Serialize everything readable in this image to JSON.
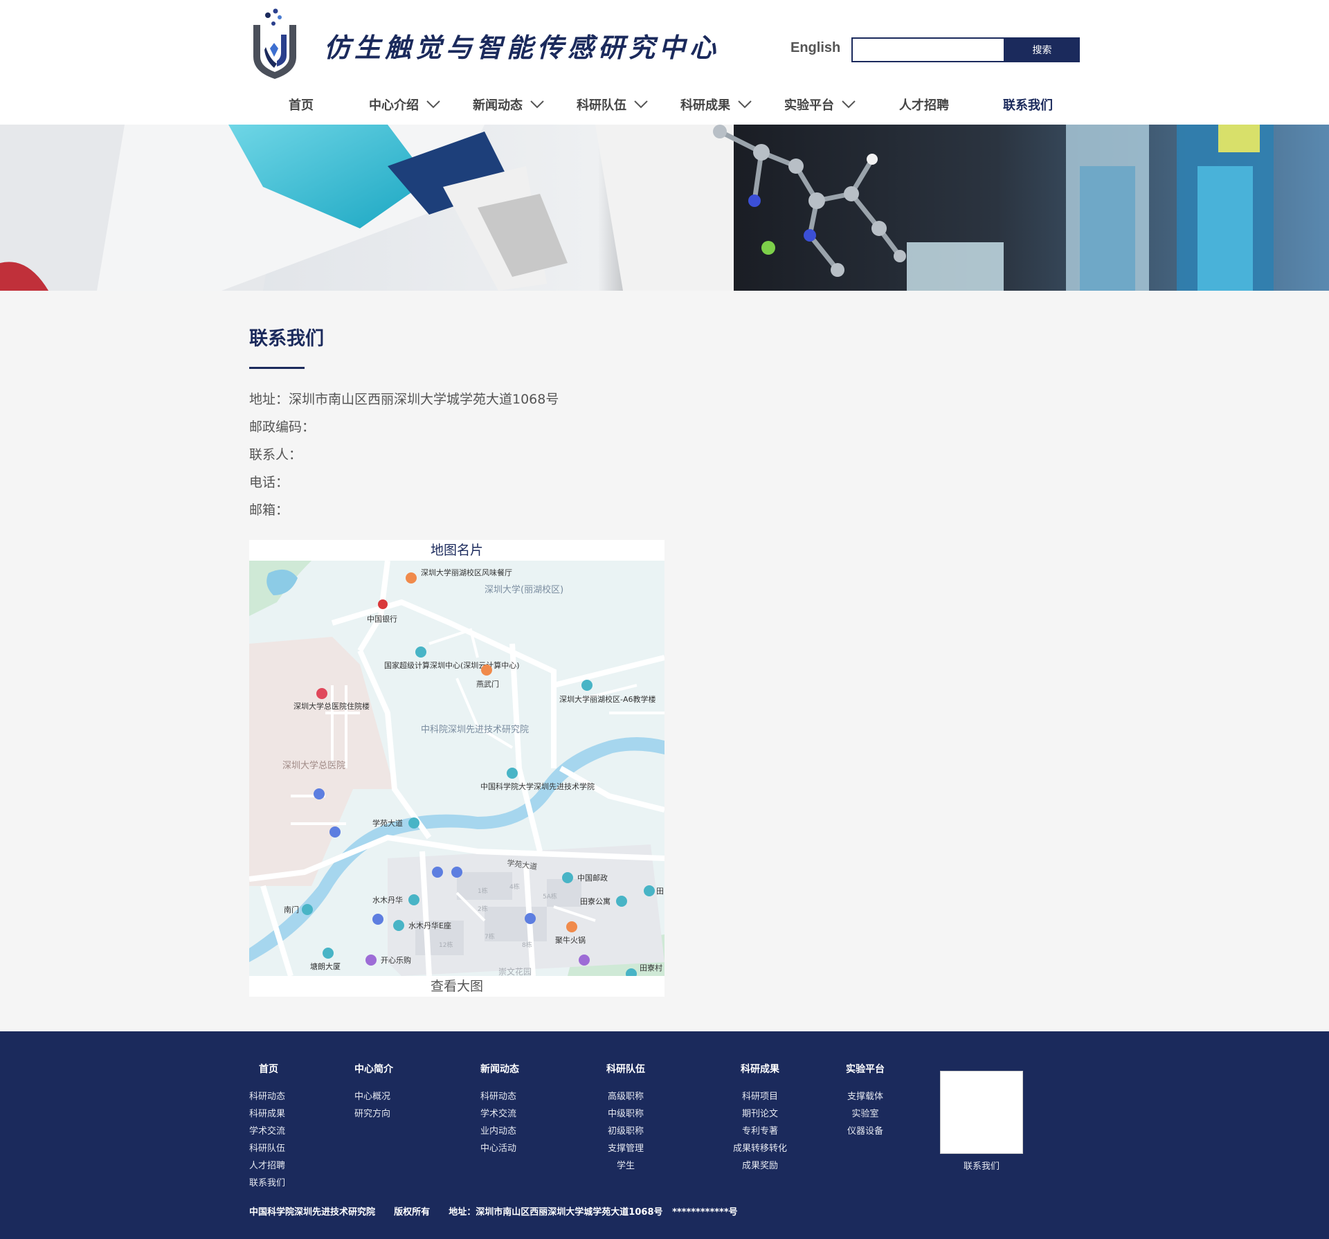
{
  "header": {
    "site_title": "仿生触觉与智能传感研究中心",
    "lang_link": "English",
    "search_placeholder": "",
    "search_button": "搜索"
  },
  "nav": [
    {
      "label": "首页",
      "dropdown": false
    },
    {
      "label": "中心介绍",
      "dropdown": true
    },
    {
      "label": "新闻动态",
      "dropdown": true
    },
    {
      "label": "科研队伍",
      "dropdown": true
    },
    {
      "label": "科研成果",
      "dropdown": true
    },
    {
      "label": "实验平台",
      "dropdown": true
    },
    {
      "label": "人才招聘",
      "dropdown": false
    },
    {
      "label": "联系我们",
      "dropdown": false,
      "active": true
    }
  ],
  "main": {
    "title": "联系我们",
    "info": [
      "地址：深圳市南山区西丽深圳大学城学苑大道1068号",
      "邮政编码：",
      "联系人：",
      "电话：",
      "邮箱："
    ],
    "map": {
      "header": "地图名片",
      "footer": "查看大图",
      "labels": {
        "restaurant": "深圳大学丽湖校区风味餐厅",
        "szu": "深圳大学(丽湖校区)",
        "boc": "中国银行",
        "supercomputer": "国家超级计算深圳中心(深圳云计算中心)",
        "yanwumen": "燕武门",
        "a6": "深圳大学丽湖校区-A6教学楼",
        "hospital_ward": "深圳大学总医院住院楼",
        "siat": "中科院深圳先进技术研究院",
        "hospital": "深圳大学总医院",
        "siat_college": "中国科学院大学深圳先进技术学院",
        "xueyuan": "学苑大道",
        "xueyuan_road": "学苑大道",
        "post": "中国邮政",
        "tian": "田",
        "shuimu": "水木丹华",
        "tianliao": "田寮公寓",
        "nanmen": "南门",
        "shuimu_e": "水木丹华E座",
        "hotpot": "聚牛火锅",
        "tanglang": "塘朗大厦",
        "kaixin": "开心乐购",
        "tianliaocun": "田寮村",
        "b1": "1栋",
        "b4": "4栋",
        "b5a": "5A栋",
        "b2": "2栋",
        "b7": "7栋",
        "b8": "8栋",
        "b12": "12栋",
        "chongwen": "崇文花园"
      }
    }
  },
  "footer": {
    "columns": [
      {
        "head": "首页",
        "links": [
          "科研动态",
          "科研成果",
          "学术交流",
          "科研队伍",
          "人才招聘",
          "联系我们"
        ]
      },
      {
        "head": "中心简介",
        "links": [
          "中心概况",
          "研究方向"
        ]
      },
      {
        "head": "新闻动态",
        "links": [
          "科研动态",
          "学术交流",
          "业内动态",
          "中心活动"
        ]
      },
      {
        "head": "科研队伍",
        "links": [
          "高级职称",
          "中级职称",
          "初级职称",
          "支撑管理",
          "学生"
        ]
      },
      {
        "head": "科研成果",
        "links": [
          "科研项目",
          "期刊论文",
          "专利专著",
          "成果转移转化",
          "成果奖励"
        ]
      },
      {
        "head": "实验平台",
        "links": [
          "支撑载体",
          "实验室",
          "仪器设备"
        ]
      }
    ],
    "qr_label": "联系我们",
    "copyright": "中国科学院深圳先进技术研究院      版权所有      地址：深圳市南山区西丽深圳大学城学苑大道1068号   ************号"
  },
  "colors": {
    "brand": "#1b2a5c",
    "background": "#f5f5f5",
    "text": "#555555"
  },
  "icons": {
    "logo": "shield-logo-icon",
    "dropdown": "chevron-down-icon"
  }
}
